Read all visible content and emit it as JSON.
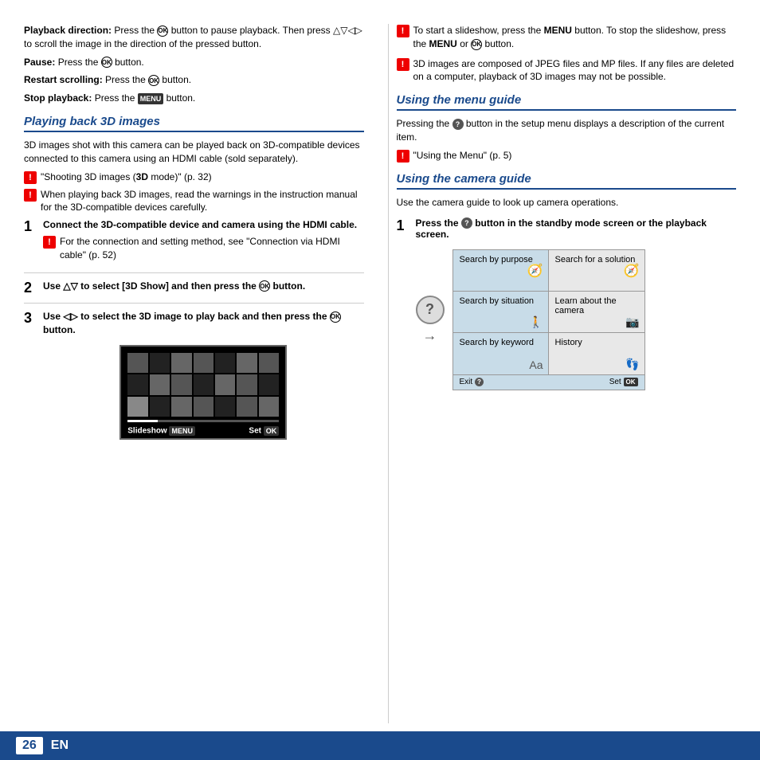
{
  "page": {
    "number": "26",
    "language": "EN"
  },
  "left": {
    "intro": {
      "playback_direction_label": "Playback direction:",
      "playback_direction_text": "Press the",
      "playback_direction_mid": "button to pause playback. Then press",
      "playback_direction_end": "to scroll the image in the direction of the pressed button.",
      "pause_label": "Pause:",
      "pause_text": "Press the",
      "pause_end": "button.",
      "restart_label": "Restart scrolling:",
      "restart_text": "Press the",
      "restart_end": "button.",
      "stop_label": "Stop playback:",
      "stop_text": "Press the",
      "stop_menu": "MENU",
      "stop_end": "button."
    },
    "section_title": "Playing back 3D images",
    "section_intro": "3D images shot with this camera can be played back on 3D-compatible devices connected to this camera using an HDMI cable (sold separately).",
    "notes": [
      "\"Shooting 3D images (3D mode)\" (p. 32)",
      "When playing back 3D images, read the warnings in the instruction manual for the 3D-compatible devices carefully."
    ],
    "steps": [
      {
        "num": "1",
        "title": "Connect the 3D-compatible device and camera using the HDMI cable.",
        "note": "For the connection and setting method, see \"Connection via HDMI cable\" (p. 52)"
      },
      {
        "num": "2",
        "title": "Use △▽ to select [3D Show] and then press the",
        "title_end": "button."
      },
      {
        "num": "3",
        "title": "Use ◁▷ to select the 3D image to play back and then press the",
        "title_end": "button."
      }
    ],
    "slideshow_label": "Slideshow",
    "slideshow_menu": "MENU",
    "slideshow_set": "Set",
    "slideshow_ok": "OK"
  },
  "right": {
    "notes_top": [
      "To start a slideshow, press the MENU button. To stop the slideshow, press the MENU or button.",
      "3D images are composed of JPEG files and MP files. If any files are deleted on a computer, playback of 3D images may not be possible."
    ],
    "menu_guide": {
      "title": "Using the menu guide",
      "intro": "Pressing the",
      "intro_mid": "button in the setup menu displays a description of the current item.",
      "note": "\"Using the Menu\" (p. 5)"
    },
    "camera_guide": {
      "title": "Using the camera guide",
      "intro": "Use the camera guide to look up camera operations.",
      "step1_title": "Press the",
      "step1_mid": "button in the standby mode screen or the playback screen.",
      "panel": {
        "cells": [
          {
            "label": "Search by purpose",
            "icon": "compass",
            "side": "left"
          },
          {
            "label": "Search for a solution",
            "icon": "compass",
            "side": "right"
          },
          {
            "label": "Search by situation",
            "icon": "figure",
            "side": "left"
          },
          {
            "label": "Learn about the camera",
            "icon": "camera",
            "side": "right"
          },
          {
            "label": "Search by keyword",
            "icon": "text",
            "side": "left"
          },
          {
            "label": "History",
            "icon": "footprint",
            "side": "right"
          }
        ],
        "footer_left": "Exit",
        "footer_right": "Set"
      }
    }
  }
}
